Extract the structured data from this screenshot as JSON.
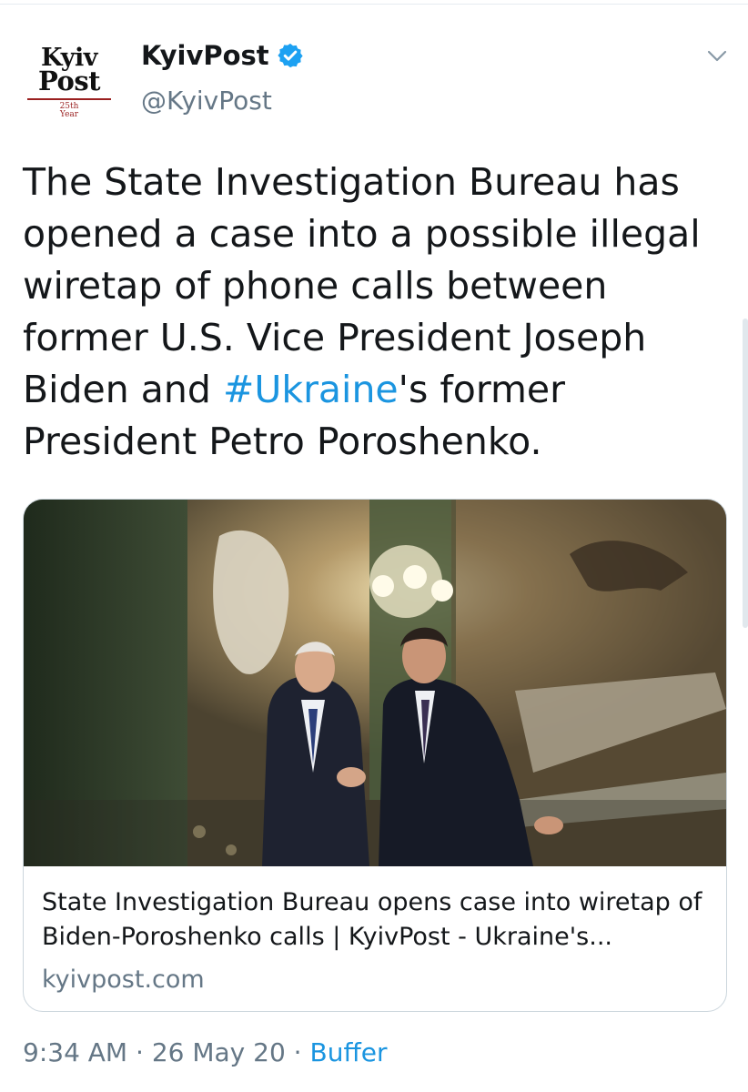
{
  "author": {
    "avatar_logo_line1": "Kyiv",
    "avatar_logo_line2": "Post",
    "avatar_anniversary": "25th Year",
    "display_name": "KyivPost",
    "handle": "@KyivPost",
    "verified": true
  },
  "tweet": {
    "text_before": "The State Investigation Bureau has opened a case into a possible illegal wiretap of phone calls between former U.S. Vice President Joseph Biden and ",
    "hashtag": "#Ukraine",
    "text_after": "'s former President Petro Poroshenko."
  },
  "link_card": {
    "image_icon": "photo-biden-poroshenko-staircase",
    "title": "State Investigation Bureau opens case into wiretap of Biden-Poroshenko calls | KyivPost - Ukraine's...",
    "domain": "kyivpost.com"
  },
  "meta": {
    "time": "9:34 AM",
    "separator": "·",
    "date": "26 May 20",
    "source": "Buffer"
  },
  "colors": {
    "accent": "#1b95e0",
    "secondary_text": "#657786",
    "border": "#ccd6dd",
    "logo_red": "#9a1f1f"
  }
}
